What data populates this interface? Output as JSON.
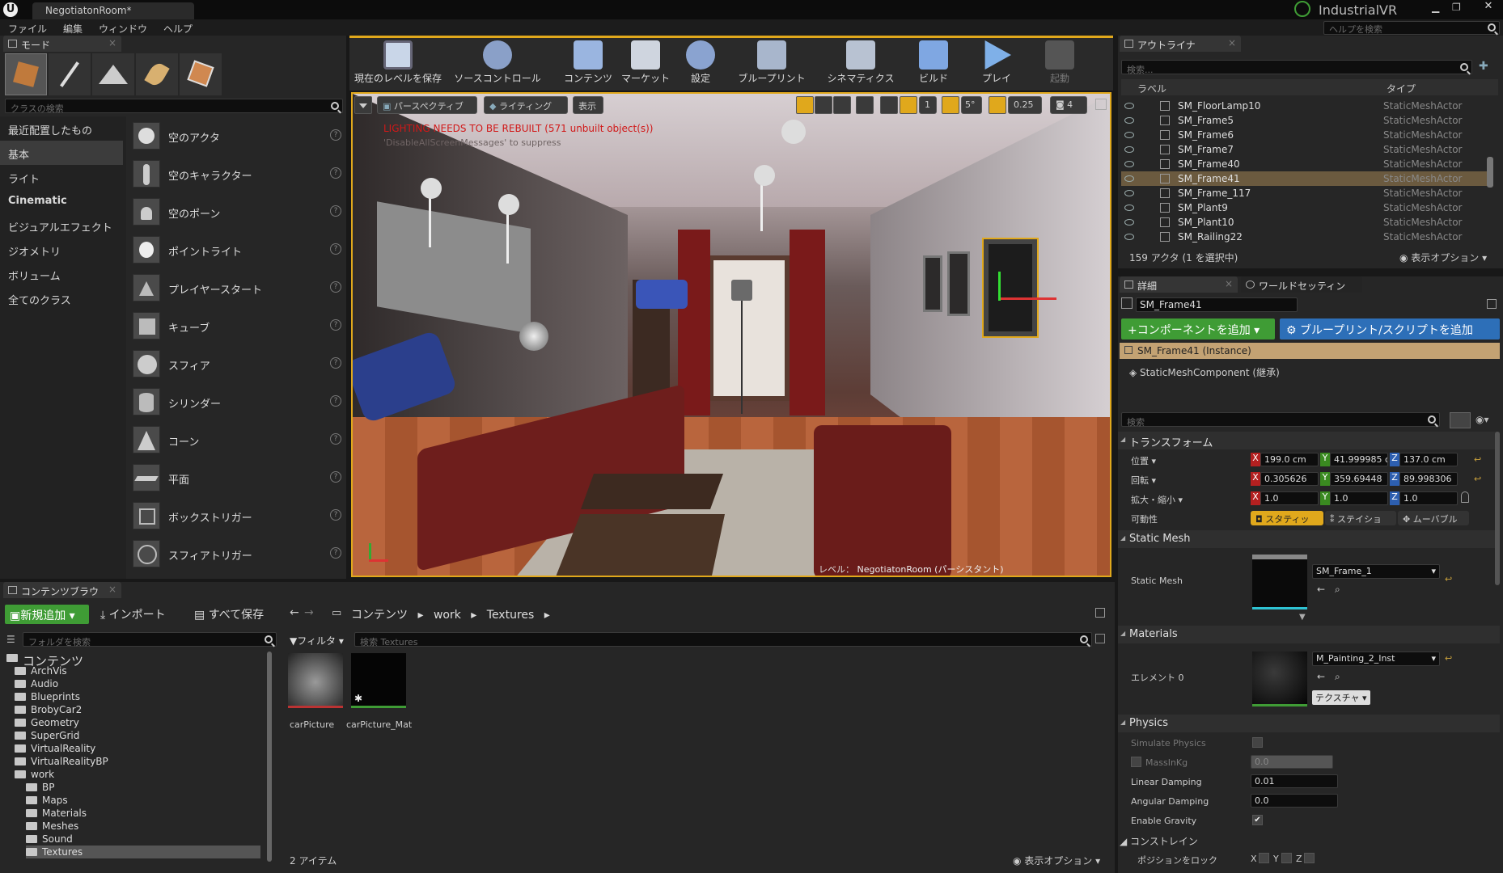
{
  "window": {
    "tab_title": "NegotiatonRoom*",
    "project": "IndustrialVR",
    "help_search_placeholder": "ヘルプを検索"
  },
  "menu": [
    "ファイル",
    "編集",
    "ウィンドウ",
    "ヘルプ"
  ],
  "modes": {
    "tab": "モード",
    "search_placeholder": "クラスの検索",
    "categories": [
      "最近配置したもの",
      "基本",
      "ライト",
      "Cinematic",
      "ビジュアルエフェクト",
      "ジオメトリ",
      "ボリューム",
      "全てのクラス"
    ],
    "selected_category": "基本",
    "actors": [
      "空のアクタ",
      "空のキャラクター",
      "空のポーン",
      "ポイントライト",
      "プレイヤースタート",
      "キューブ",
      "スフィア",
      "シリンダー",
      "コーン",
      "平面",
      "ボックストリガー",
      "スフィアトリガー"
    ]
  },
  "toolbar": {
    "buttons": [
      "現在のレベルを保存",
      "ソースコントロール",
      "コンテンツ",
      "マーケット",
      "設定",
      "ブループリント",
      "シネマティクス",
      "ビルド",
      "プレイ",
      "起動"
    ]
  },
  "viewport": {
    "perspective": "パースペクティブ",
    "lighting": "ライティング",
    "show": "表示",
    "warning": "LIGHTING NEEDS TO BE REBUILT (571 unbuilt object(s))",
    "warning2": "'DisableAllScreenMessages' to suppress",
    "grid_snap": "1",
    "rot_snap": "5°",
    "scale_snap": "0.25",
    "cam_speed": "4",
    "level_label": "レベル：",
    "level_name": "NegotiatonRoom (パーシスタント)"
  },
  "outliner": {
    "tab": "アウトライナ",
    "search_placeholder": "検索...",
    "col_label": "ラベル",
    "col_type": "タイプ",
    "rows": [
      {
        "name": "SM_FloorLamp10",
        "type": "StaticMeshActor"
      },
      {
        "name": "SM_Frame5",
        "type": "StaticMeshActor"
      },
      {
        "name": "SM_Frame6",
        "type": "StaticMeshActor"
      },
      {
        "name": "SM_Frame7",
        "type": "StaticMeshActor"
      },
      {
        "name": "SM_Frame40",
        "type": "StaticMeshActor"
      },
      {
        "name": "SM_Frame41",
        "type": "StaticMeshActor"
      },
      {
        "name": "SM_Frame_117",
        "type": "StaticMeshActor"
      },
      {
        "name": "SM_Plant9",
        "type": "StaticMeshActor"
      },
      {
        "name": "SM_Plant10",
        "type": "StaticMeshActor"
      },
      {
        "name": "SM_Railing22",
        "type": "StaticMeshActor"
      }
    ],
    "selected_row": 5,
    "count": "159 アクタ (1 を選択中)",
    "view_options": "表示オプション"
  },
  "details": {
    "tab": "詳細",
    "tab2": "ワールドセッティン",
    "actor_name": "SM_Frame41",
    "add_component": "コンポーネントを追加",
    "blueprint_script": "ブループリント/スクリプトを追加",
    "instance": "SM_Frame41 (Instance)",
    "component": "StaticMeshComponent (継承)",
    "search_placeholder": "検索",
    "transform": {
      "section": "トランスフォーム",
      "location_label": "位置",
      "rotation_label": "回転",
      "scale_label": "拡大・縮小",
      "mobility_label": "可動性",
      "location": [
        "199.0 cm",
        "41.999985 c",
        "137.0 cm"
      ],
      "rotation": [
        "0.305626",
        "359.69448",
        "89.998306"
      ],
      "scale": [
        "1.0",
        "1.0",
        "1.0"
      ],
      "mobility": [
        "スタティッ",
        "ステイショ",
        "ムーバブル"
      ]
    },
    "static_mesh": {
      "section": "Static Mesh",
      "label": "Static Mesh",
      "value": "SM_Frame_1"
    },
    "materials": {
      "section": "Materials",
      "label": "エレメント 0",
      "value": "M_Painting_2_Inst",
      "texture_btn": "テクスチャ"
    },
    "physics": {
      "section": "Physics",
      "simulate": "Simulate Physics",
      "mass": "MassInKg",
      "mass_value": "0.0",
      "linear": "Linear Damping",
      "linear_value": "0.01",
      "angular": "Angular Damping",
      "angular_value": "0.0",
      "gravity": "Enable Gravity",
      "constraints": "コンストレイン",
      "lock_position": "ポジションをロック",
      "x": "X",
      "y": "Y",
      "z": "Z"
    }
  },
  "content_browser": {
    "tab": "コンテンツブラウ",
    "add_new": "新規追加",
    "import": "インポート",
    "save_all": "すべて保存",
    "path": [
      "コンテンツ",
      "work",
      "Textures"
    ],
    "folder_search_placeholder": "フォルダを検索",
    "filter": "フィルタ",
    "asset_search_placeholder": "検索 Textures",
    "tree": [
      {
        "name": "コンテンツ",
        "depth": 0
      },
      {
        "name": "ArchVis",
        "depth": 1
      },
      {
        "name": "Audio",
        "depth": 1
      },
      {
        "name": "Blueprints",
        "depth": 1
      },
      {
        "name": "BrobyCar2",
        "depth": 1
      },
      {
        "name": "Geometry",
        "depth": 1
      },
      {
        "name": "SuperGrid",
        "depth": 1
      },
      {
        "name": "VirtualReality",
        "depth": 1
      },
      {
        "name": "VirtualRealityBP",
        "depth": 1
      },
      {
        "name": "work",
        "depth": 1
      },
      {
        "name": "BP",
        "depth": 2
      },
      {
        "name": "Maps",
        "depth": 2
      },
      {
        "name": "Materials",
        "depth": 2
      },
      {
        "name": "Meshes",
        "depth": 2
      },
      {
        "name": "Sound",
        "depth": 2
      },
      {
        "name": "Textures",
        "depth": 2
      }
    ],
    "selected_folder": "Textures",
    "assets": [
      "carPicture",
      "carPicture_Mat"
    ],
    "item_count": "2 アイテム",
    "view_options": "表示オプション"
  },
  "colors": {
    "accent_green": "#3f9c35",
    "selection": "#6b5a3f",
    "warning_red": "#d11818",
    "viewport_border": "#e0a81c"
  }
}
